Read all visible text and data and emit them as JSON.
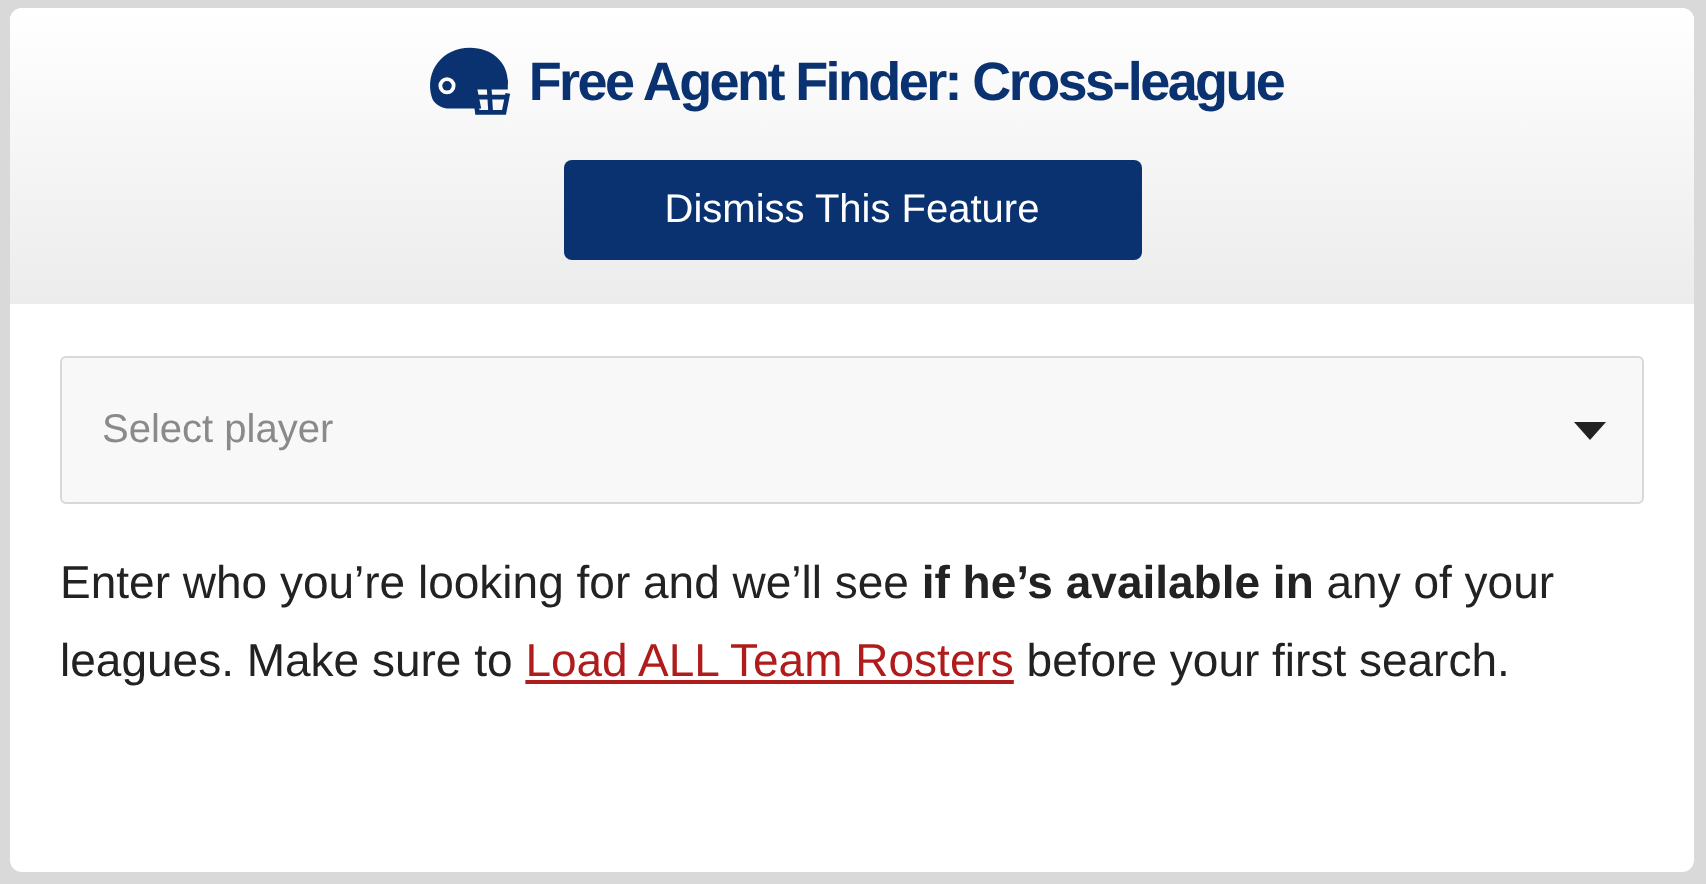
{
  "header": {
    "title": "Free Agent Finder: Cross-league",
    "dismiss_button": "Dismiss This Feature"
  },
  "player_select": {
    "placeholder": "Select player"
  },
  "description": {
    "before": "Enter who you’re looking for and we’ll see **if he’s available in** any of your leagues. Make sure to ",
    "link": "Load ALL Team Rosters",
    "after": " before your first search."
  }
}
